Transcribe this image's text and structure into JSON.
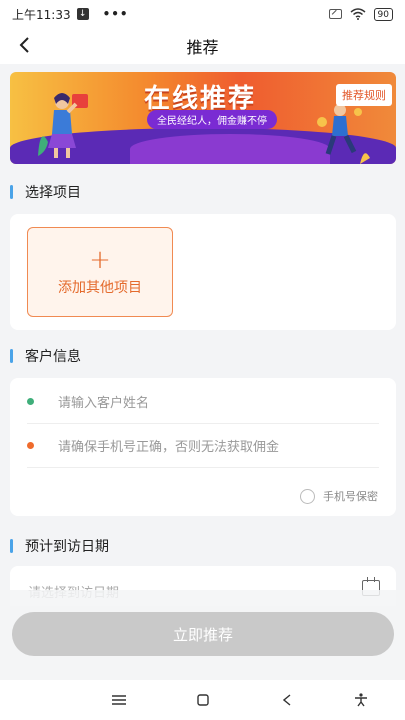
{
  "status_bar": {
    "time": "上午11:33",
    "more": "•••",
    "battery": "90"
  },
  "header": {
    "title": "推荐"
  },
  "banner": {
    "title": "在线推荐",
    "subtitle": "全民经纪人，佣金赚不停",
    "rules_button": "推荐规则"
  },
  "project_section": {
    "title": "选择项目",
    "add_label": "添加其他项目",
    "add_plus": "+"
  },
  "customer_section": {
    "title": "客户信息",
    "name_placeholder": "请输入客户姓名",
    "phone_placeholder": "请确保手机号正确，否则无法获取佣金",
    "privacy_label": "手机号保密",
    "dot_colors": {
      "name": "#3fae7a",
      "phone": "#ef6b2c"
    }
  },
  "visit_section": {
    "title": "预计到访日期",
    "date_placeholder": "请选择到访日期"
  },
  "submit": {
    "label": "立即推荐"
  },
  "colors": {
    "accent": "#4aa3e8",
    "orange": "#e46a2c",
    "disabled": "#c9c9c9"
  }
}
